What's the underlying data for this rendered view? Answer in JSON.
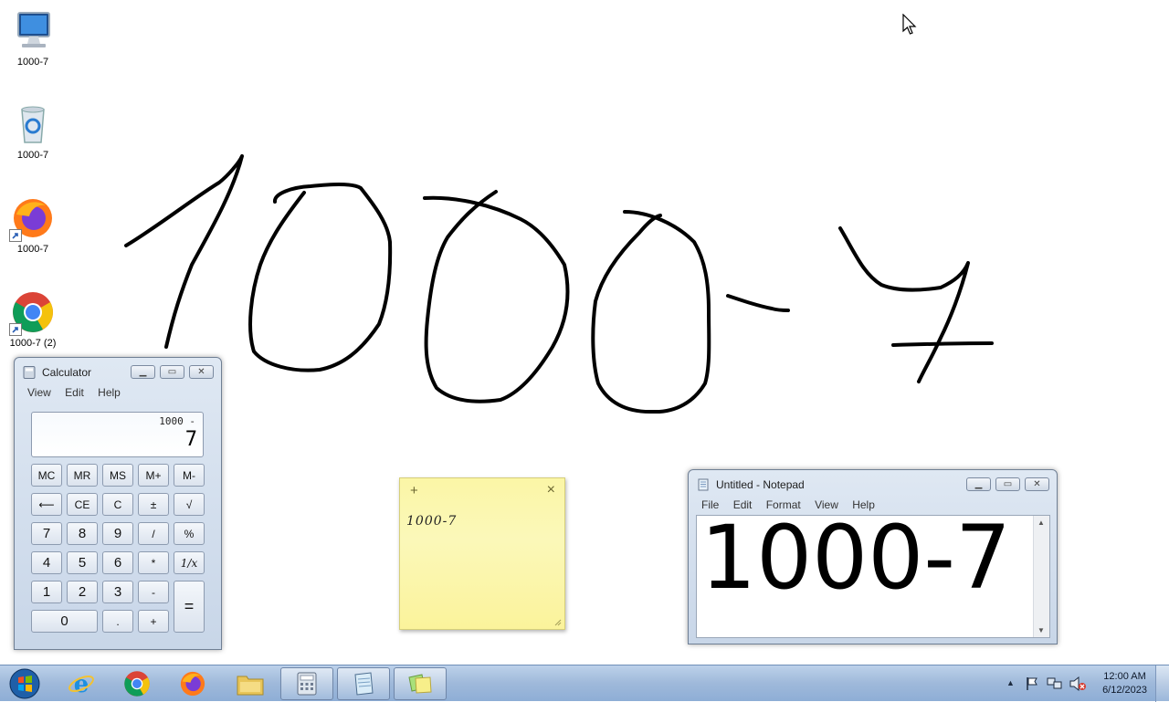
{
  "desktop": {
    "icons": [
      {
        "label": "1000-7",
        "icon": "computer-icon"
      },
      {
        "label": "1000-7",
        "icon": "recycle-bin-icon"
      },
      {
        "label": "1000-7",
        "icon": "firefox-icon"
      },
      {
        "label": "1000-7 (2)",
        "icon": "chrome-icon"
      }
    ]
  },
  "calculator": {
    "title": "Calculator",
    "menu": [
      "View",
      "Edit",
      "Help"
    ],
    "expression": "1000 -",
    "display_value": "7",
    "buttons": {
      "mc": "MC",
      "mr": "MR",
      "ms": "MS",
      "mplus": "M+",
      "mminus": "M-",
      "back": "⟵",
      "ce": "CE",
      "c": "C",
      "plusminus": "±",
      "sqrt": "√",
      "seven": "7",
      "eight": "8",
      "nine": "9",
      "divide": "/",
      "percent": "%",
      "four": "4",
      "five": "5",
      "six": "6",
      "multiply": "*",
      "reciprocal": "1/x",
      "one": "1",
      "two": "2",
      "three": "3",
      "minus": "-",
      "equals": "=",
      "zero": "0",
      "dot": ".",
      "plus": "+"
    }
  },
  "sticky_note": {
    "add_glyph": "+",
    "close_glyph": "×",
    "text": "1000-7"
  },
  "notepad": {
    "title": "Untitled - Notepad",
    "menu": [
      "File",
      "Edit",
      "Format",
      "View",
      "Help"
    ],
    "content": "1000-7"
  },
  "taskbar": {
    "pinned": [
      "start-orb",
      "internet-explorer",
      "chrome",
      "firefox",
      "file-explorer",
      "calculator",
      "notepad",
      "sticky-notes"
    ],
    "clock_time": "12:00 AM",
    "clock_date": "6/12/2023",
    "tray_icons": [
      "show-hidden-icons",
      "action-center-flag",
      "network",
      "volume-muted"
    ]
  },
  "colors": {
    "taskbar": "#9fb9da",
    "window_frame": "#c8d6e8",
    "sticky": "#fbf6a6",
    "ink": "#000000"
  }
}
